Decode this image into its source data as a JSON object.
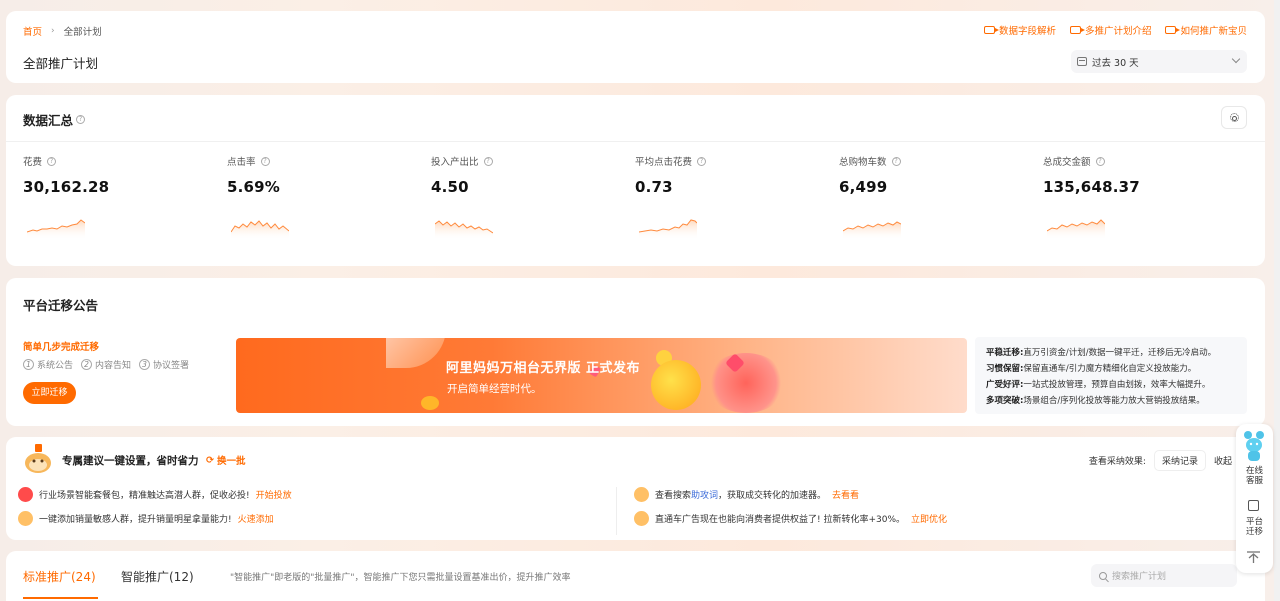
{
  "header": {
    "breadcrumb": {
      "home": "首页",
      "current": "全部计划"
    },
    "links": [
      "数据字段解析",
      "多推广计划介绍",
      "如何推广新宝贝"
    ],
    "page_title": "全部推广计划",
    "date_range": "过去 30 天"
  },
  "summary": {
    "title": "数据汇总",
    "metrics": [
      {
        "label": "花费",
        "value": "30,162.28"
      },
      {
        "label": "点击率",
        "value": "5.69%"
      },
      {
        "label": "投入产出比",
        "value": "4.50"
      },
      {
        "label": "平均点击花费",
        "value": "0.73"
      },
      {
        "label": "总购物车数",
        "value": "6,499"
      },
      {
        "label": "总成交金额",
        "value": "135,648.37"
      }
    ]
  },
  "migration": {
    "title": "平台迁移公告",
    "steps_title": "简单几步完成迁移",
    "steps": [
      {
        "num": "1",
        "label": "系统公告"
      },
      {
        "num": "2",
        "label": "内容告知"
      },
      {
        "num": "3",
        "label": "协议签署"
      }
    ],
    "button": "立即迁移",
    "banner_title": "阿里妈妈万相台无界版 正式发布",
    "banner_subtitle": "开启简单经营时代。",
    "info": [
      {
        "key": "平稳迁移:",
        "text": "直万引资金/计划/数据一键平迁，迁移后无冷启动。"
      },
      {
        "key": "习惯保留:",
        "text": "保留直通车/引力魔方精细化自定义投放能力。"
      },
      {
        "key": "广受好评:",
        "text": "一站式投放管理，预算自由划拨，效率大幅提升。"
      },
      {
        "key": "多项突破:",
        "text": "场景组合/序列化投放等能力放大营销投放结果。"
      }
    ]
  },
  "suggestions": {
    "title": "专属建议一键设置，省时省力",
    "refresh": "换一批",
    "effect_label": "查看采纳效果:",
    "record": "采纳记录",
    "collapse": "收起",
    "items": [
      {
        "text": "行业场景智能套餐包，精准触达高潜人群，促收必投!",
        "action": "开始投放"
      },
      {
        "text": "一键添加销量敏感人群，提升销量明星拿量能力!",
        "action": "火速添加"
      },
      {
        "pre": "查看搜索",
        "link": "助攻词",
        "post": "，获取成交转化的加速器。",
        "action": "去看看"
      },
      {
        "text": "直通车广告现在也能向消费者提供权益了! 拉新转化率+30%。",
        "action": "立即优化"
      }
    ]
  },
  "tabs": {
    "items": [
      {
        "label": "标准推广(24)"
      },
      {
        "label": "智能推广(12)"
      }
    ],
    "description": "\"智能推广\"即老版的\"批量推广\"，智能推广下您只需批量设置基准出价，提升推广效率",
    "search_placeholder": "搜索推广计划"
  },
  "side": {
    "service": "在线客服",
    "migrate": "平台迁移"
  },
  "colors": {
    "accent": "#ff6a00",
    "link": "#3a6ad8"
  },
  "icons": [
    "video-icon",
    "calendar-icon",
    "chevron-down-icon",
    "help-icon",
    "gear-icon",
    "refresh-icon",
    "rocket-icon",
    "search-icon",
    "robot-icon",
    "copy-icon",
    "back-to-top-icon"
  ]
}
